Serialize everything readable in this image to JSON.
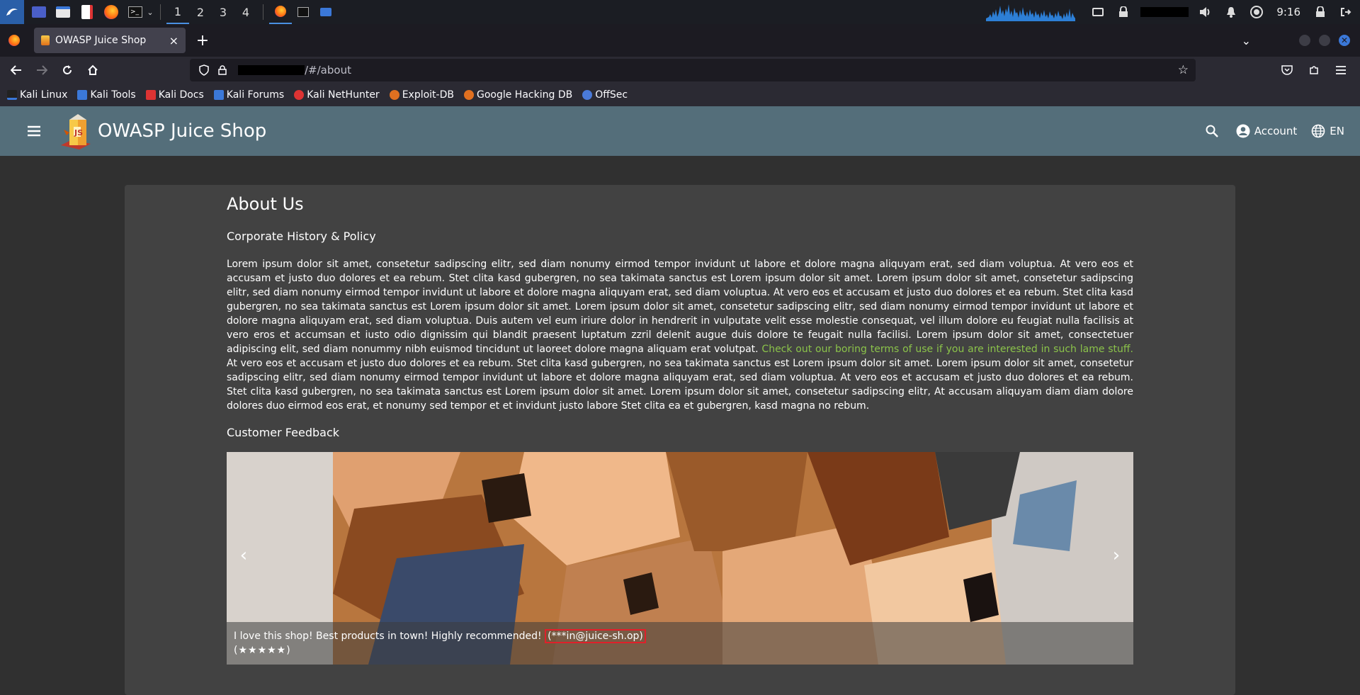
{
  "os": {
    "workspaces": [
      "1",
      "2",
      "3",
      "4"
    ],
    "clock": "9:16"
  },
  "browser": {
    "tab_title": "OWASP Juice Shop",
    "tab_close": "×",
    "new_tab": "+",
    "url_path": "/#/about",
    "bookmarks": [
      {
        "label": "Kali Linux",
        "color": "#3b78d8"
      },
      {
        "label": "Kali Tools",
        "color": "#3b78d8"
      },
      {
        "label": "Kali Docs",
        "color": "#d33"
      },
      {
        "label": "Kali Forums",
        "color": "#3b78d8"
      },
      {
        "label": "Kali NetHunter",
        "color": "#d33"
      },
      {
        "label": "Exploit-DB",
        "color": "#e07020"
      },
      {
        "label": "Google Hacking DB",
        "color": "#e07020"
      },
      {
        "label": "OffSec",
        "color": "#4a7ad8"
      }
    ]
  },
  "app": {
    "title": "OWASP Juice Shop",
    "account_label": "Account",
    "language_label": "EN"
  },
  "about": {
    "heading": "About Us",
    "history_heading": "Corporate History & Policy",
    "paragraph_part1": "Lorem ipsum dolor sit amet, consetetur sadipscing elitr, sed diam nonumy eirmod tempor invidunt ut labore et dolore magna aliquyam erat, sed diam voluptua. At vero eos et accusam et justo duo dolores et ea rebum. Stet clita kasd gubergren, no sea takimata sanctus est Lorem ipsum dolor sit amet. Lorem ipsum dolor sit amet, consetetur sadipscing elitr, sed diam nonumy eirmod tempor invidunt ut labore et dolore magna aliquyam erat, sed diam voluptua. At vero eos et accusam et justo duo dolores et ea rebum. Stet clita kasd gubergren, no sea takimata sanctus est Lorem ipsum dolor sit amet. Lorem ipsum dolor sit amet, consetetur sadipscing elitr, sed diam nonumy eirmod tempor invidunt ut labore et dolore magna aliquyam erat, sed diam voluptua. Duis autem vel eum iriure dolor in hendrerit in vulputate velit esse molestie consequat, vel illum dolore eu feugiat nulla facilisis at vero eros et accumsan et iusto odio dignissim qui blandit praesent luptatum zzril delenit augue duis dolore te feugait nulla facilisi. Lorem ipsum dolor sit amet, consectetuer adipiscing elit, sed diam nonummy nibh euismod tincidunt ut laoreet dolore magna aliquam erat volutpat. ",
    "terms_link": "Check out our boring terms of use if you are interested in such lame stuff.",
    "paragraph_part2": " At vero eos et accusam et justo duo dolores et ea rebum. Stet clita kasd gubergren, no sea takimata sanctus est Lorem ipsum dolor sit amet. Lorem ipsum dolor sit amet, consetetur sadipscing elitr, sed diam nonumy eirmod tempor invidunt ut labore et dolore magna aliquyam erat, sed diam voluptua. At vero eos et accusam et justo duo dolores et ea rebum. Stet clita kasd gubergren, no sea takimata sanctus est Lorem ipsum dolor sit amet. Lorem ipsum dolor sit amet, consetetur sadipscing elitr, At accusam aliquyam diam diam dolore dolores duo eirmod eos erat, et nonumy sed tempor et et invidunt justo labore Stet clita ea et gubergren, kasd magna no rebum.",
    "feedback_heading": "Customer Feedback"
  },
  "feedback": {
    "comment": "I love this shop! Best products in town! Highly recommended! ",
    "author": "(***in@juice-sh.op)",
    "stars": "(★★★★★)",
    "prev": "‹",
    "next": "›"
  }
}
